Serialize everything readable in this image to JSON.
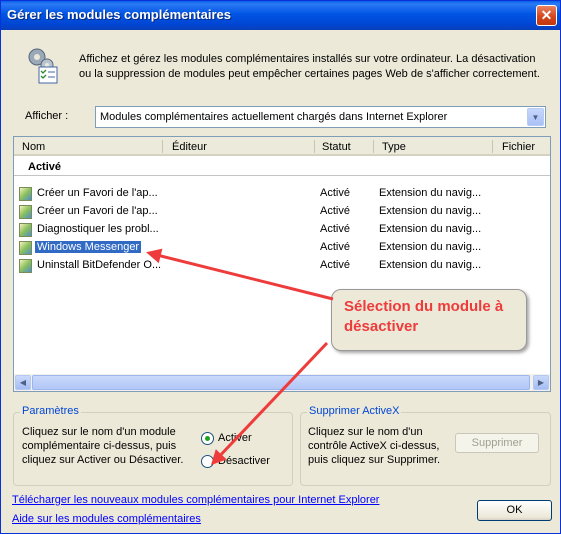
{
  "window": {
    "title": "Gérer les modules complémentaires",
    "close_glyph": "✕"
  },
  "header": {
    "icon": "gears-checklist-icon",
    "description": "Affichez et gérez les modules complémentaires installés sur votre ordinateur. La désactivation ou la suppression de modules peut empêcher certaines pages Web de s'afficher correctement."
  },
  "show": {
    "label": "Afficher :",
    "selected": "Modules complémentaires actuellement chargés dans Internet Explorer"
  },
  "list": {
    "columns": [
      "Nom",
      "Éditeur",
      "Statut",
      "Type",
      "Fichier"
    ],
    "group": "Activé",
    "rows": [
      {
        "name": "Créer un Favori de l'ap...",
        "status": "Activé",
        "type": "Extension du navig..."
      },
      {
        "name": "Créer un Favori de l'ap...",
        "status": "Activé",
        "type": "Extension du navig..."
      },
      {
        "name": "Diagnostiquer les probl...",
        "status": "Activé",
        "type": "Extension du navig..."
      },
      {
        "name": "Windows Messenger",
        "status": "Activé",
        "type": "Extension du navig..."
      },
      {
        "name": "Uninstall BitDefender O...",
        "status": "Activé",
        "type": "Extension du navig..."
      }
    ],
    "selected_index": 3
  },
  "settings": {
    "legend": "Paramètres",
    "text": "Cliquez sur le nom d'un module complémentaire ci-dessus, puis cliquez sur Activer ou Désactiver.",
    "enable_label": "Activer",
    "disable_label": "Désactiver",
    "selected": "enable"
  },
  "activex": {
    "legend": "Supprimer ActiveX",
    "text": "Cliquez sur le nom d'un contrôle ActiveX ci-dessus, puis cliquez sur Supprimer.",
    "delete_label": "Supprimer"
  },
  "links": {
    "download": "Télécharger les nouveaux modules complémentaires pour Internet Explorer",
    "help": "Aide sur les modules complémentaires"
  },
  "ok_label": "OK",
  "annotation": {
    "text": "Sélection du module à désactiver",
    "color": "#ee3b3b"
  },
  "colors": {
    "titlebar": "#0054e3",
    "selection": "#316ac5",
    "dialog": "#ece9d8"
  }
}
